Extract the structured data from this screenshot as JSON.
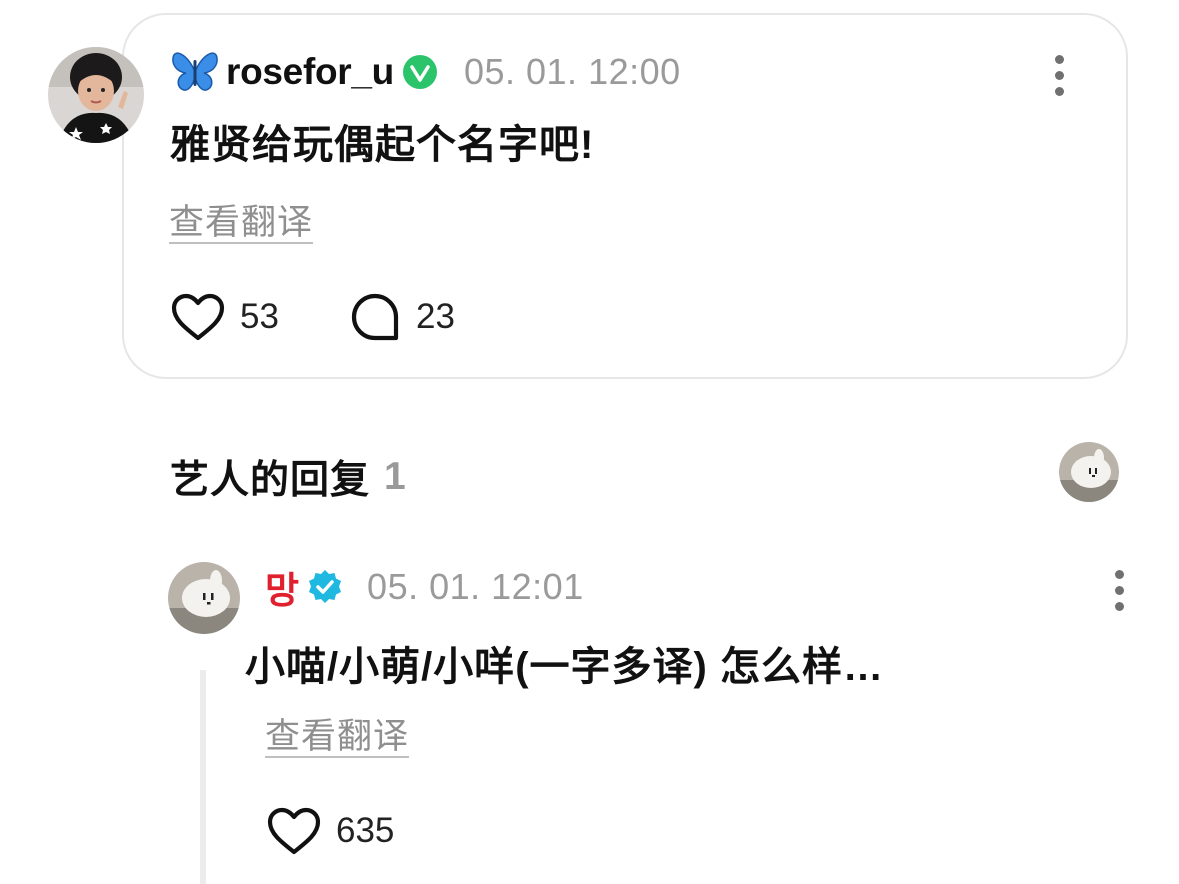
{
  "post": {
    "username_emoji": "🦋",
    "username": "rosefor_u",
    "timestamp": "05. 01. 12:00",
    "text": "雅贤给玩偶起个名字吧!",
    "translate_label": "查看翻译",
    "like_count": "53",
    "comment_count": "23"
  },
  "artist_replies": {
    "title": "艺人的回复",
    "count": "1"
  },
  "reply": {
    "username": "망",
    "timestamp": "05. 01. 12:01",
    "text": "小喵/小萌/小咩(一字多译) 怎么样…",
    "translate_label": "查看翻译",
    "like_count": "635"
  },
  "colors": {
    "verified_green": "#2cc46b",
    "verified_blue": "#1fb8e0",
    "reply_username": "#e0202d",
    "muted_text": "#9a9a9a"
  }
}
